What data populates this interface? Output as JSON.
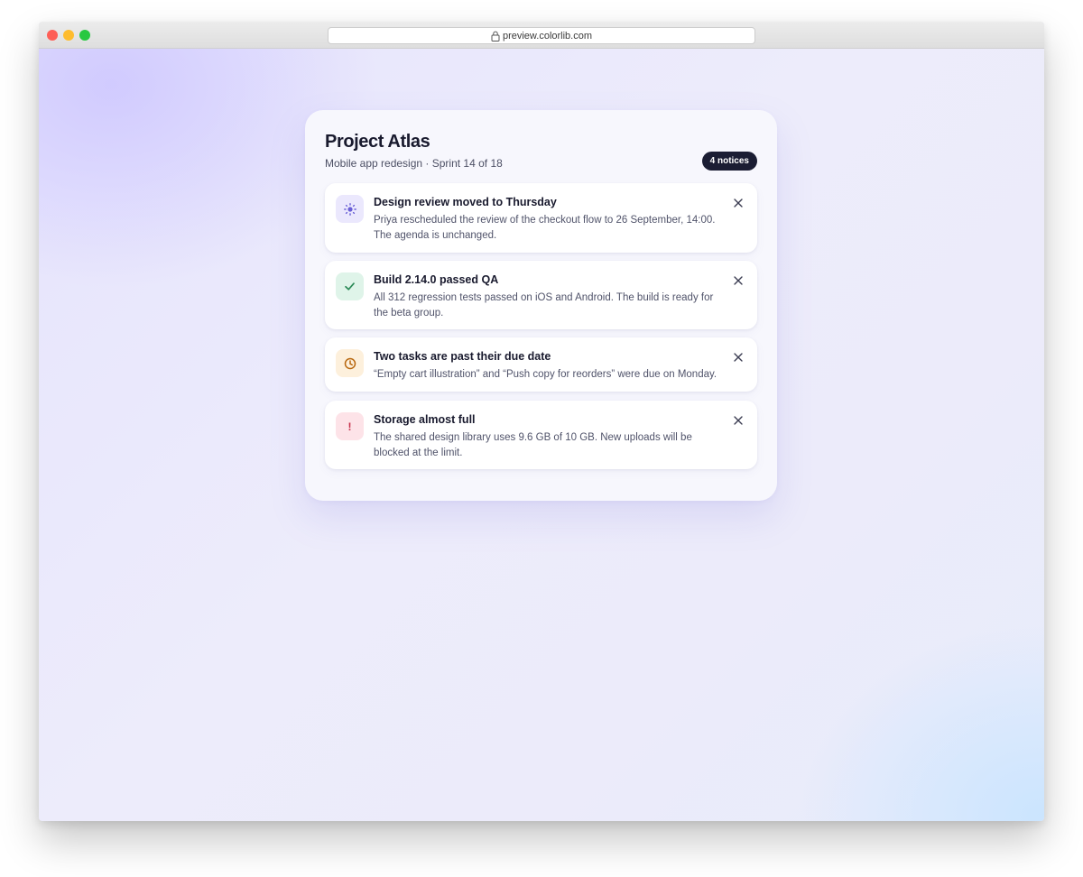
{
  "browser": {
    "url": "preview.colorlib.com"
  },
  "panel": {
    "title": "Project Atlas",
    "subtitle": "Mobile app redesign · Sprint 14 of 18",
    "badge": "4 notices"
  },
  "notices": [
    {
      "title": "Design review moved to Thursday",
      "body": "Priya rescheduled the review of the checkout flow to 26 September, 14:00. The agenda is unchanged.",
      "icon": "sun-icon",
      "icon_bg": "#ebe8fd",
      "icon_color": "#6a5fd6"
    },
    {
      "title": "Build 2.14.0 passed QA",
      "body": "All 312 regression tests passed on iOS and Android. The build is ready for the beta group.",
      "icon": "check-icon",
      "icon_bg": "#dff4e9",
      "icon_color": "#2b8a57"
    },
    {
      "title": "Two tasks are past their due date",
      "body": "“Empty cart illustration” and “Push copy for reorders” were due on Monday.",
      "icon": "clock-icon",
      "icon_bg": "#fdf0dc",
      "icon_color": "#b8670e"
    },
    {
      "title": "Storage almost full",
      "body": "The shared design library uses 9.6 GB of 10 GB. New uploads will be blocked at the limit.",
      "icon": "exclamation-icon",
      "icon_glyph": "!",
      "icon_bg": "#fde3e8",
      "icon_color": "#c7304a"
    }
  ]
}
